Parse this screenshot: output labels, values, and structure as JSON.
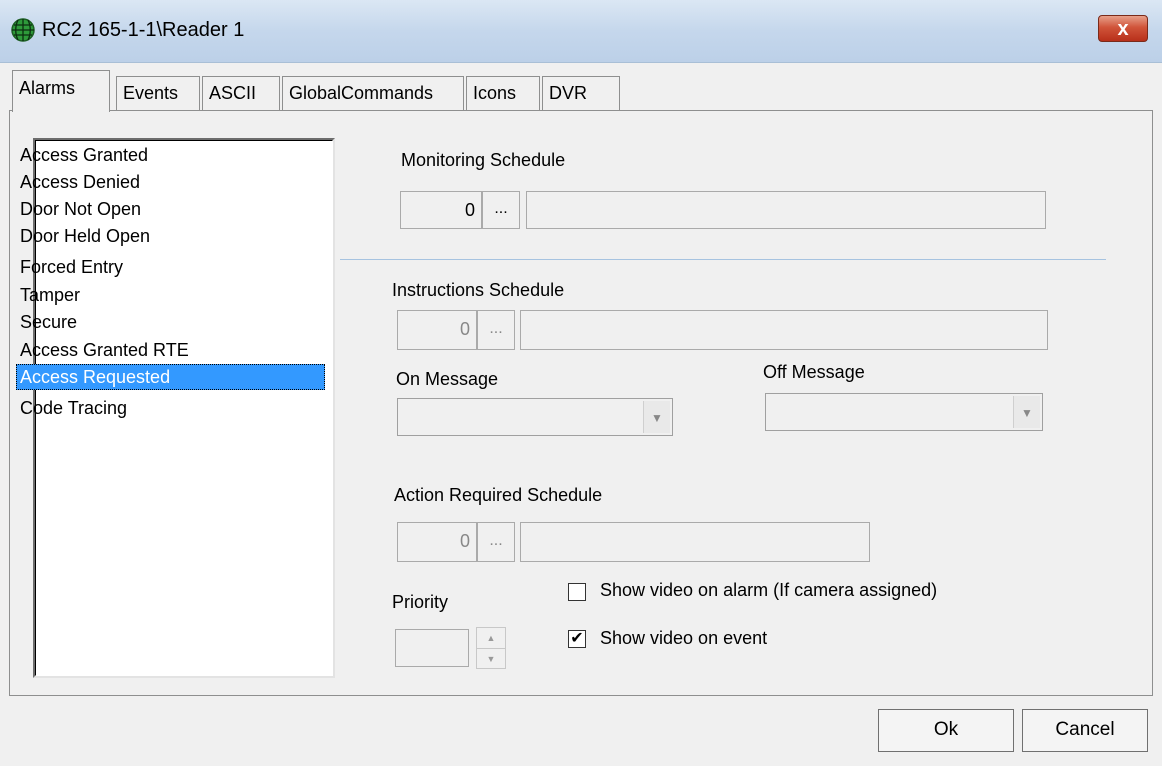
{
  "window": {
    "title": "RC2 165-1-1\\Reader 1",
    "close_glyph": "x",
    "icon": "globe-grid-icon"
  },
  "tabs": [
    "Alarms",
    "Events",
    "ASCII",
    "GlobalCommands",
    "Icons",
    "DVR"
  ],
  "active_tab": "Alarms",
  "alarm_list": {
    "items": [
      "Access Granted",
      "Access Denied",
      "Door Not Open",
      "Door Held Open",
      "Forced Entry",
      "Tamper",
      "Secure",
      "Access Granted RTE",
      "Access Requested",
      "Code Tracing"
    ],
    "selected": "Access Requested"
  },
  "monitoring": {
    "label": "Monitoring Schedule",
    "value": "0",
    "browse": "...",
    "name": ""
  },
  "instructions": {
    "label": "Instructions Schedule",
    "value": "0",
    "browse": "...",
    "name": ""
  },
  "on_message": {
    "label": "On Message",
    "value": ""
  },
  "off_message": {
    "label": "Off Message",
    "value": ""
  },
  "action_required": {
    "label": "Action Required Schedule",
    "value": "0",
    "browse": "...",
    "name": ""
  },
  "priority": {
    "label": "Priority",
    "value": ""
  },
  "show_video_alarm": {
    "label": "Show video on alarm (If camera assigned)",
    "checked": false
  },
  "show_video_event": {
    "label": "Show video on event",
    "checked": true,
    "mark": "✔"
  },
  "buttons": {
    "ok": "Ok",
    "cancel": "Cancel"
  },
  "colors": {
    "selection": "#3399ff",
    "close": "#c8402a"
  }
}
